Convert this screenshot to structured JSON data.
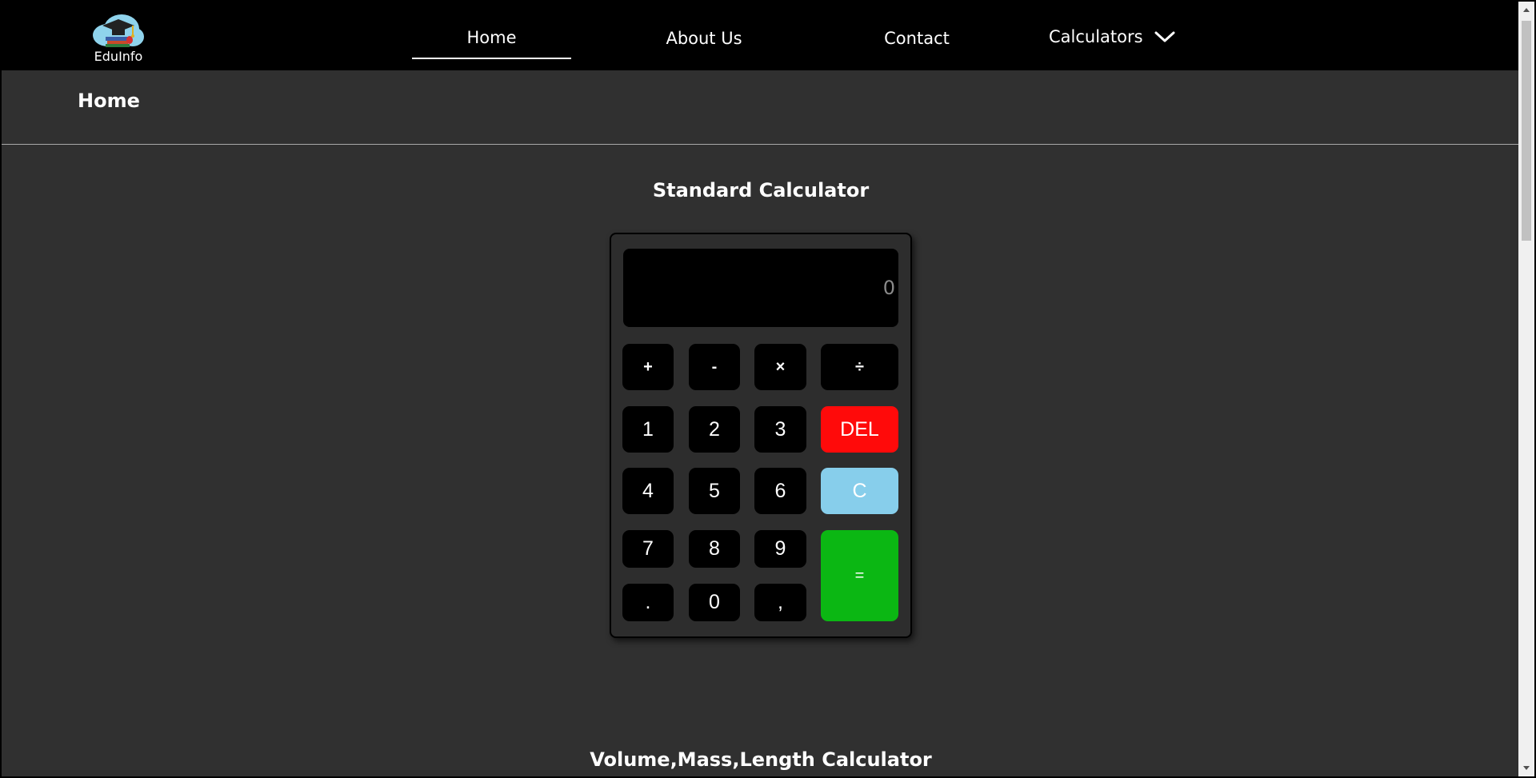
{
  "brand": {
    "name": "EduInfo"
  },
  "nav": {
    "home": "Home",
    "about": "About Us",
    "contact": "Contact",
    "calculators": "Calculators",
    "active": "Home"
  },
  "page": {
    "title": "Home"
  },
  "standard_calculator": {
    "title": "Standard Calculator",
    "display_value": "0",
    "keys": {
      "plus": "+",
      "minus": "-",
      "multiply": "×",
      "divide": "÷",
      "one": "1",
      "two": "2",
      "three": "3",
      "del": "DEL",
      "four": "4",
      "five": "5",
      "six": "6",
      "clear": "C",
      "seven": "7",
      "eight": "8",
      "nine": "9",
      "equals": "=",
      "dot": ".",
      "zero": "0",
      "comma": ","
    }
  },
  "next_section": {
    "title": "Volume,Mass,Length Calculator"
  },
  "colors": {
    "background": "#303030",
    "navbar": "#000000",
    "key": "#000000",
    "del": "#ff0a0a",
    "clear": "#87ceeb",
    "equals": "#0bb713"
  },
  "icons": {
    "logo": "graduation-cap-cloud-logo",
    "dropdown": "chevron-down-icon"
  }
}
